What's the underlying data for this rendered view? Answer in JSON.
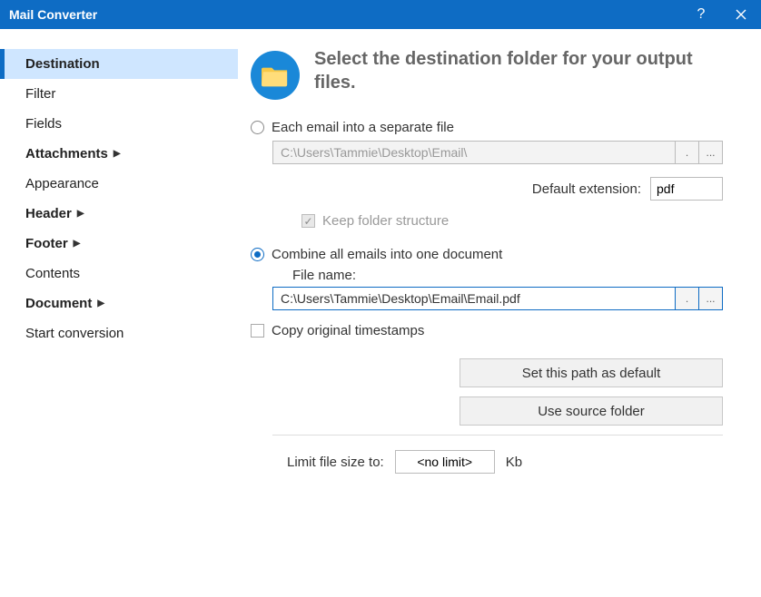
{
  "titlebar": {
    "title": "Mail Converter",
    "help_tooltip": "Help",
    "close_tooltip": "Close"
  },
  "sidebar": {
    "items": [
      {
        "label": "Destination",
        "bold": true,
        "active": true,
        "chev": false
      },
      {
        "label": "Filter",
        "bold": false,
        "active": false,
        "chev": false
      },
      {
        "label": "Fields",
        "bold": false,
        "active": false,
        "chev": false
      },
      {
        "label": "Attachments",
        "bold": true,
        "active": false,
        "chev": true
      },
      {
        "label": "Appearance",
        "bold": false,
        "active": false,
        "chev": false
      },
      {
        "label": "Header",
        "bold": true,
        "active": false,
        "chev": true
      },
      {
        "label": "Footer",
        "bold": true,
        "active": false,
        "chev": true
      },
      {
        "label": "Contents",
        "bold": false,
        "active": false,
        "chev": false
      },
      {
        "label": "Document",
        "bold": true,
        "active": false,
        "chev": true
      },
      {
        "label": "Start conversion",
        "bold": false,
        "active": false,
        "chev": false
      }
    ]
  },
  "main": {
    "heading": "Select the destination folder for your output files.",
    "opt_separate": {
      "label": "Each email into a separate file",
      "path": "C:\\Users\\Tammie\\Desktop\\Email\\",
      "selected": false
    },
    "default_ext_label": "Default extension:",
    "default_ext_value": "pdf",
    "keep_folder_label": "Keep folder structure",
    "keep_folder_checked": true,
    "opt_combine": {
      "label": "Combine all emails into one document",
      "filename_label": "File name:",
      "path": "C:\\Users\\Tammie\\Desktop\\Email\\Email.pdf",
      "selected": true
    },
    "copy_ts_label": "Copy original timestamps",
    "copy_ts_checked": false,
    "btn_default": "Set this path as default",
    "btn_source": "Use source folder",
    "limit_label": "Limit file size to:",
    "limit_value": "<no limit>",
    "limit_unit": "Kb",
    "dot_btn": ".",
    "browse_btn": "..."
  }
}
